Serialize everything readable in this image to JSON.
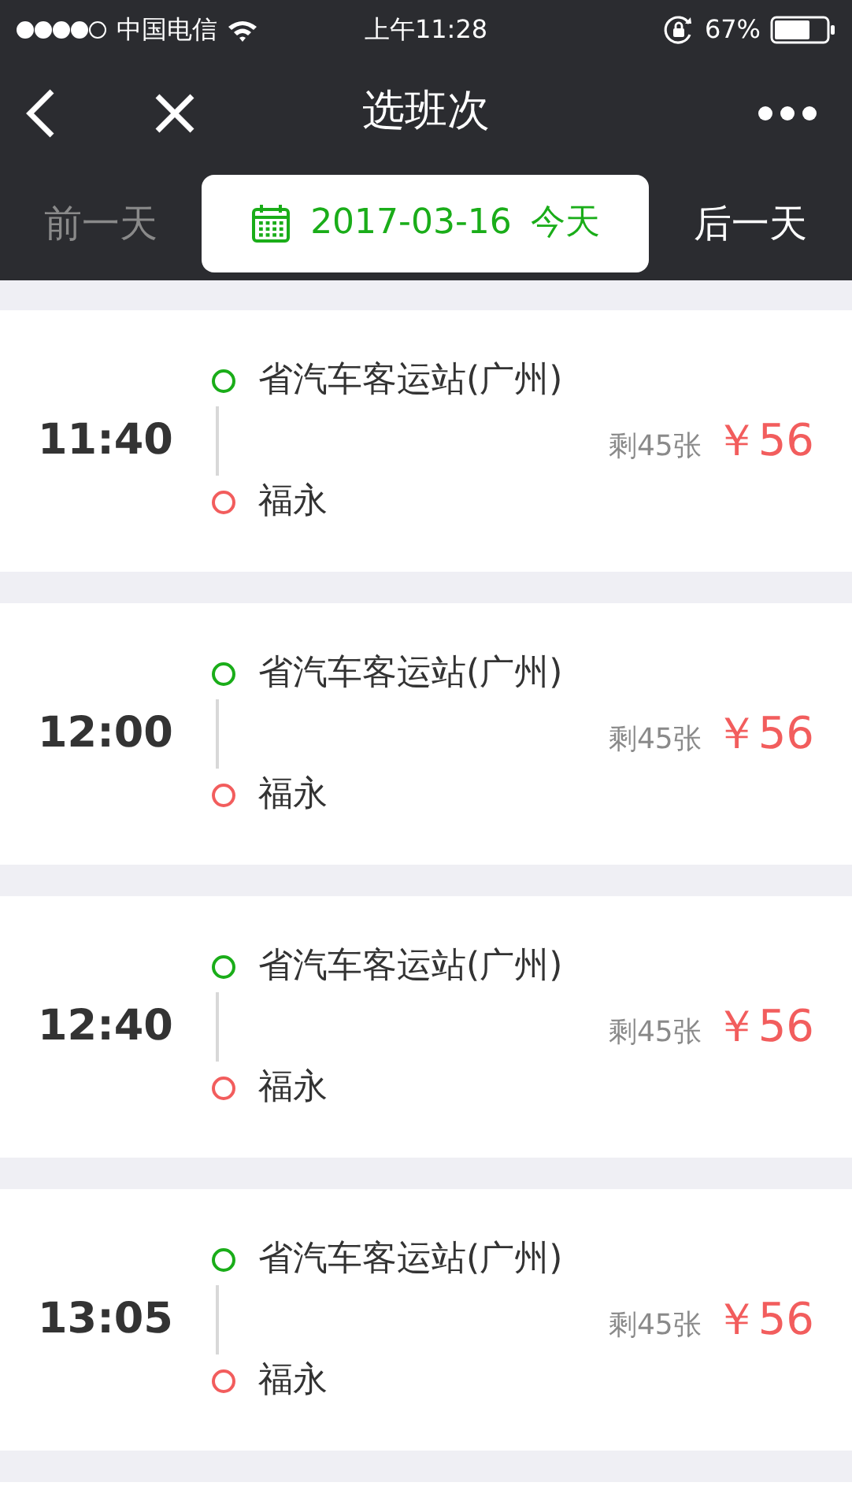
{
  "status_bar": {
    "carrier": "中国电信",
    "time": "上午11:28",
    "battery": "67%"
  },
  "nav_bar": {
    "title": "选班次"
  },
  "date_bar": {
    "prev": "前一天",
    "date": "2017-03-16",
    "today": "今天",
    "next": "后一天"
  },
  "trips": [
    {
      "time": "11:40",
      "from": "省汽车客运站(广州)",
      "to": "福永",
      "remaining": "剩45张",
      "price": "￥56"
    },
    {
      "time": "12:00",
      "from": "省汽车客运站(广州)",
      "to": "福永",
      "remaining": "剩45张",
      "price": "￥56"
    },
    {
      "time": "12:40",
      "from": "省汽车客运站(广州)",
      "to": "福永",
      "remaining": "剩45张",
      "price": "￥56"
    },
    {
      "time": "13:05",
      "from": "省汽车客运站(广州)",
      "to": "福永",
      "remaining": "剩45张",
      "price": "￥56"
    }
  ]
}
